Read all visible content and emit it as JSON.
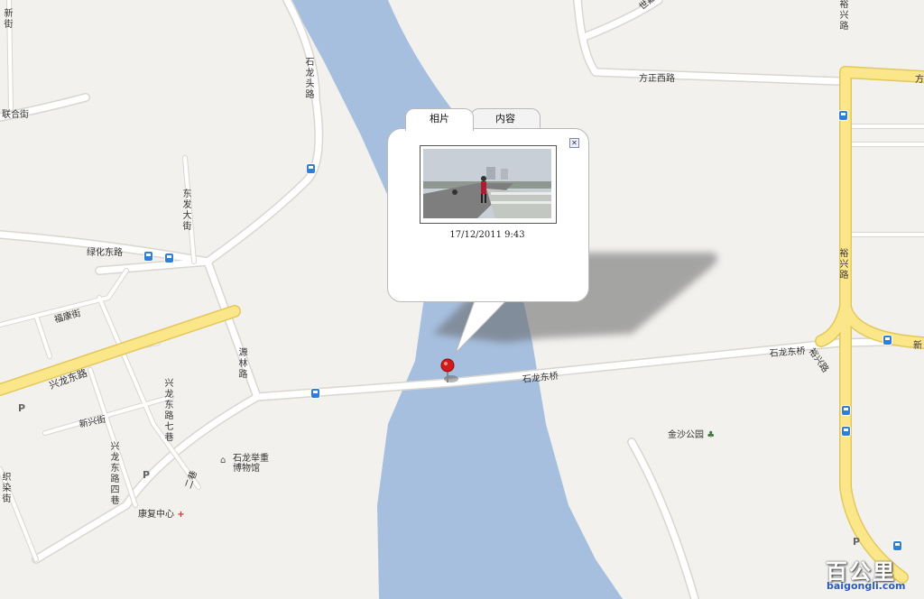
{
  "map": {
    "roads": {
      "shilongtou": "石龙头路",
      "dongfa": "东发大街",
      "lvhua_east": "绿化东路",
      "xinghua": "新街",
      "lianhe": "联合街",
      "fukang": "福康街",
      "xinglong_east": "兴龙东路",
      "yuanlin": "源林路",
      "xinglong_7": "兴龙东路七巷",
      "xinglong_4": "兴龙东路四巷",
      "xinxing": "新兴街",
      "zhizuo": "织染街",
      "shilong_bridge_1": "石龙东桥",
      "shilong_bridge_2": "石龙东桥",
      "fangzheng_west": "方正西路",
      "fangzheng_edge": "方",
      "yuxing_top": "裕兴路",
      "yuxing_mid": "裕兴路",
      "yuxing_diag": "裕兴路",
      "xin_edge": "新",
      "shijia": "世嘉路",
      "longan": "二巷"
    },
    "pois": {
      "museum": "石龙举重博物馆",
      "rehab": "康复中心",
      "park": "金沙公园",
      "parking": "P"
    },
    "colors": {
      "water": "#a6bfdf",
      "land": "#f2f1ee",
      "road": "#ffffff",
      "main_road": "#fbe78a",
      "main_road_border": "#e2c85a",
      "marker": "#d21b1b",
      "bus": "#2f7fd8"
    }
  },
  "popup": {
    "tabs": [
      "相片",
      "内容"
    ],
    "active_tab": "相片",
    "timestamp": "17/12/2011 9:43",
    "close_icon": "close-icon"
  },
  "logo": {
    "title": "百公里",
    "url": "baigongli.com"
  }
}
